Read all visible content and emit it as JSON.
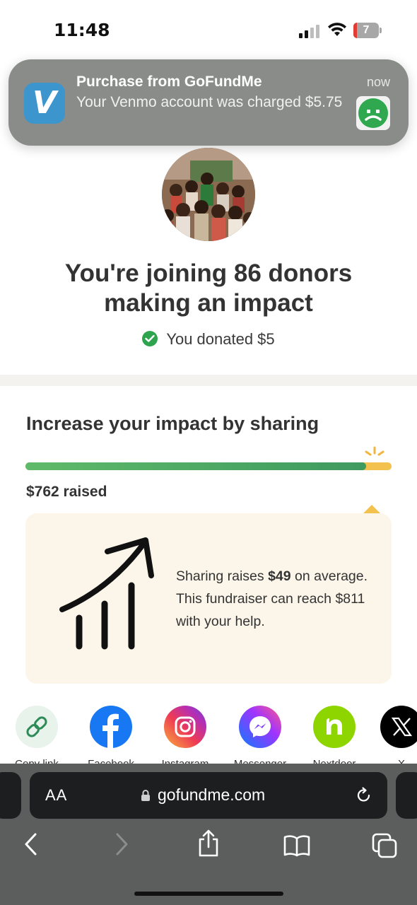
{
  "status_bar": {
    "time": "11:48",
    "battery": "7"
  },
  "notification": {
    "app_icon_letter": "V",
    "title": "Purchase from GoFundMe",
    "body": "Your Venmo account was charged $5.75",
    "time": "now"
  },
  "hero": {
    "headline": "You're joining 86 donors making an impact",
    "donated_text": "You donated $5"
  },
  "sharing": {
    "title": "Increase your impact by sharing",
    "progress_fraction": 0.93,
    "raised_text": "$762 raised",
    "info_prefix": "Sharing raises ",
    "info_amount": "$49",
    "info_suffix": " on average. This fundraiser can reach $811 with your help.",
    "share_options": [
      {
        "label": "Copy link",
        "icon": "link-icon"
      },
      {
        "label": "Facebook",
        "icon": "facebook-icon"
      },
      {
        "label": "Instagram",
        "icon": "instagram-icon"
      },
      {
        "label": "Messenger",
        "icon": "messenger-icon"
      },
      {
        "label": "Nextdoor",
        "icon": "nextdoor-icon"
      },
      {
        "label": "X",
        "icon": "x-icon"
      }
    ]
  },
  "browser": {
    "text_size_label": "AA",
    "url": "gofundme.com"
  },
  "colors": {
    "progress_green": "#3e9a5f",
    "progress_gold": "#f2c14e",
    "card_bg": "#fcf6ea",
    "venmo_blue": "#3d95ce"
  }
}
